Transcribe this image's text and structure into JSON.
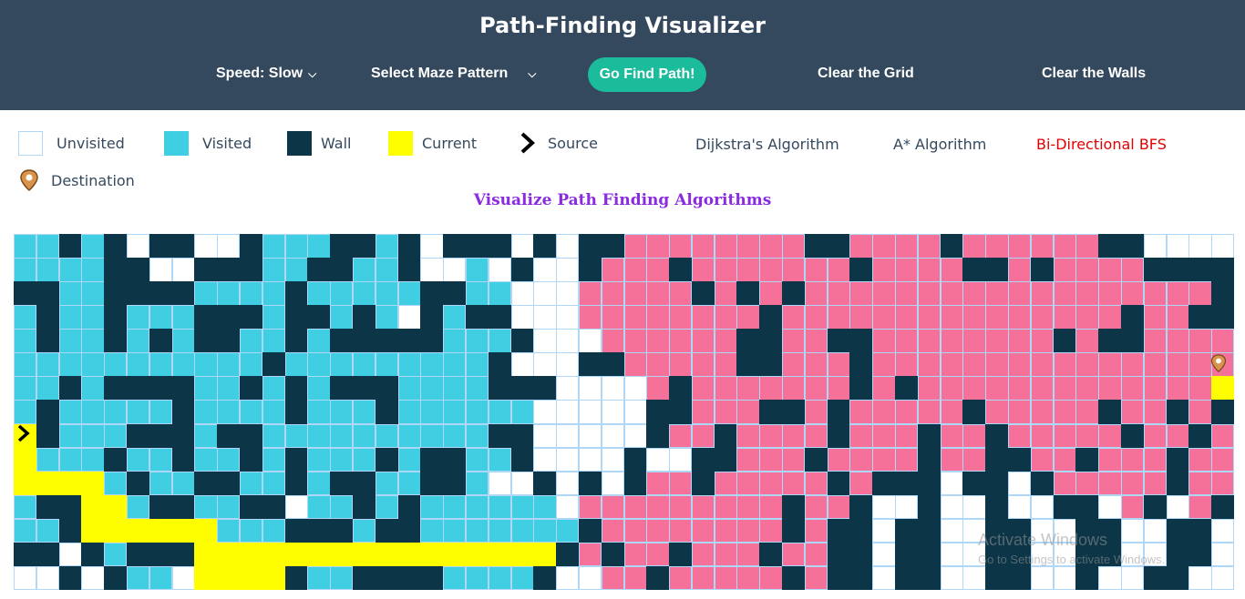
{
  "header": {
    "title": "Path-Finding Visualizer",
    "speed_label": "Speed: Slow",
    "maze_label": "Select Maze Pattern",
    "go_label": "Go Find Path!",
    "clear_grid_label": "Clear the Grid",
    "clear_walls_label": "Clear the Walls"
  },
  "legend": {
    "unvisited": "Unvisited",
    "visited": "Visited",
    "wall": "Wall",
    "current": "Current",
    "source": "Source",
    "destination": "Destination"
  },
  "algorithms": {
    "dijkstra": "Dijkstra's Algorithm",
    "astar": "A* Algorithm",
    "bfs": "Bi-Directional BFS"
  },
  "subtitle": "Visualize Path Finding Algorithms",
  "colors": {
    "header_bg": "#34495e",
    "accent": "#1abc9c",
    "visited": "#40cee3",
    "visited_from_target": "#f57199",
    "wall": "#0c3547",
    "current": "#fffe00",
    "active_algorithm": "#e30000"
  },
  "grid": {
    "rows": 15,
    "cols": 50,
    "cells": [
      "VVWVWUWWUUWVVVWWVWUWWWUWUWWPPPPPPPPWWPPPPWPPPPPPWWUUUU",
      "VVVVWWUUWWWVVWWVVWUUVUWUUWPPPWPPPPPPPWPPPPWWPWPPPPWWWW",
      "WWVVWWWWVVVVWVVVVVWWVVUUUPPPPPWPWPWPPPPPPPPPPPPPPPPPPW",
      "VWVVWVVVWWWVWWVWVUWVWWUUUPPPPPPPPWPPPPPPPPPPPPPPPWPPWW",
      "VWVVWVWVWWVVWVWWWWWVVVWUUUPPPPPPWWPPWWPPPPPPPPWPWWPPPP",
      "VVVVVVVVVVVWVVVVVVVVVWUUUWWPPPPPWWPPPWPPPPPPPPPPPPPPPP",
      "VVWVWWWWVVWVWVWWWVVVVWWWUUUUPWPPPPPPPWPWPPPPPPPPPPPPPY",
      "VWVVVVVWVVVVWVVVWVVVVVVUUUUUWWPPPWWPWPPPPPWPPPPPWPPWPW",
      "YWVVVWWWVWWVVVVVVVVVVWWUUUUUWPPWPPPPWPPPWPPWPPPPPWPPWP",
      "YVVVWVVWVVWVWVVVWVWWVVWUUUUWUUWWPPPWPPPPWPPWWPPWPPPWPP",
      "YYYYVWVVWWVVWVWWVVWWVUUWUWUWPPWPPPPPWPWWWUWWUWPPPPPWPP",
      "VWWYYVWWVVWWUVVWVWVVVVVVUPPPPPPPPPWPPWUUWUUWUUWWUPWUPW",
      "VVWYYYYYYVVVWWWVWWVVVVVVVWPPPPPPPPWPWWUWWUUWWUUWWUUWWU",
      "WWUWVWWWYYYYYYYYYYYYYYYYWPWPPWPPPWPPWWUWWUUWWUUWWUUWWU",
      "UUWUWVVUYYYYWVVWWWWVVVVWUUPPWPPPPPWPWWUWWUUWWUUWUUWWUU"
    ]
  },
  "watermark": {
    "line1": "Activate Windows",
    "line2": "Go to Settings to activate Windows."
  }
}
